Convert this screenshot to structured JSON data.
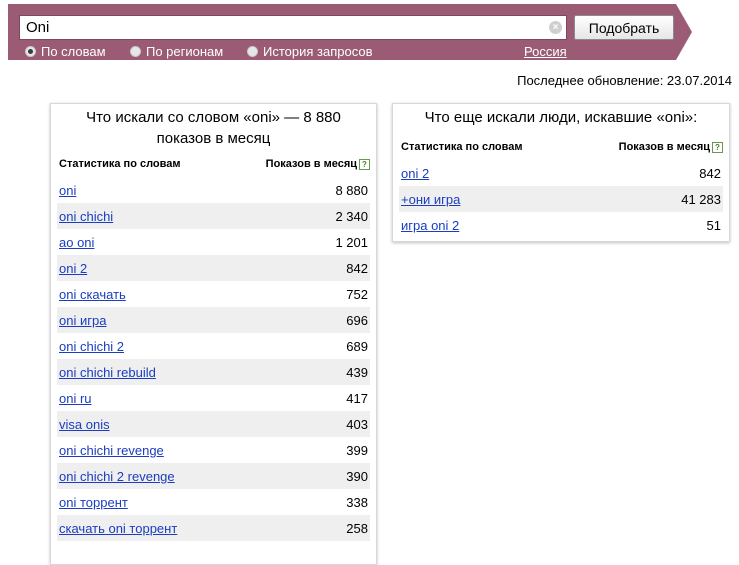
{
  "search": {
    "query": "Oni",
    "submit_label": "Подобрать",
    "clear_icon": "×"
  },
  "modes": [
    {
      "label": "По словам",
      "selected": true
    },
    {
      "label": "По регионам",
      "selected": false
    },
    {
      "label": "История запросов",
      "selected": false
    }
  ],
  "region": "Россия",
  "last_update": "Последнее обновление: 23.07.2014",
  "left_panel": {
    "title": "Что искали со словом «oni» — 8 880 показов в месяц",
    "col_word": "Статистика по словам",
    "col_count": "Показов в месяц",
    "help": "?",
    "rows": [
      {
        "phrase": "oni",
        "count": "8 880"
      },
      {
        "phrase": "oni chichi",
        "count": "2 340"
      },
      {
        "phrase": "ao oni",
        "count": "1 201"
      },
      {
        "phrase": "oni 2",
        "count": "842"
      },
      {
        "phrase": "oni скачать",
        "count": "752"
      },
      {
        "phrase": "oni игра",
        "count": "696"
      },
      {
        "phrase": "oni chichi 2",
        "count": "689"
      },
      {
        "phrase": "oni chichi rebuild",
        "count": "439"
      },
      {
        "phrase": "oni ru",
        "count": "417"
      },
      {
        "phrase": "visa onis",
        "count": "403"
      },
      {
        "phrase": "oni chichi revenge",
        "count": "399"
      },
      {
        "phrase": "oni chichi 2 revenge",
        "count": "390"
      },
      {
        "phrase": "oni торрент",
        "count": "338"
      },
      {
        "phrase": "скачать oni торрент",
        "count": "258"
      }
    ]
  },
  "right_panel": {
    "title": "Что еще искали люди, искавшие «oni»:",
    "col_word": "Статистика по словам",
    "col_count": "Показов в месяц",
    "help": "?",
    "rows": [
      {
        "phrase": "oni 2",
        "count": "842"
      },
      {
        "phrase": "+они игра",
        "count": "41 283"
      },
      {
        "phrase": "игра oni 2",
        "count": "51"
      }
    ]
  },
  "colors": {
    "bar": "#9b5b75",
    "link": "#1a3dc1",
    "row_alt": "#efefef"
  }
}
